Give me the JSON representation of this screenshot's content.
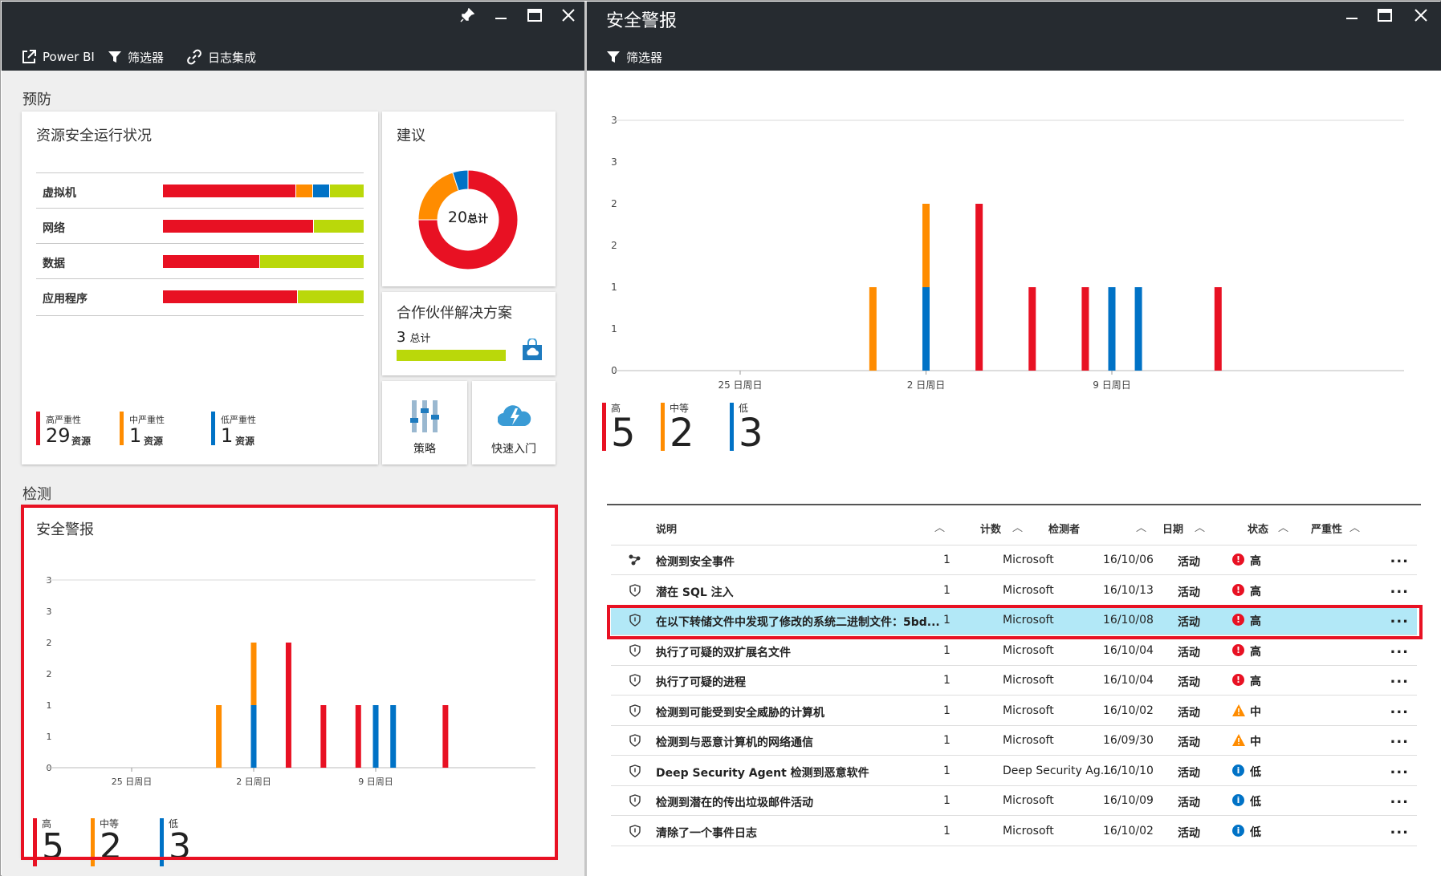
{
  "left_blade": {
    "toolbar": {
      "powerbi_label": "Power BI",
      "filter_label": "筛选器",
      "log_label": "日志集成"
    },
    "prevention": {
      "section_label": "预防",
      "resource_health": {
        "title": "资源安全运行状况",
        "rows": [
          {
            "label": "虚拟机",
            "high": 0.67,
            "medium": 0.08,
            "low": 0.08,
            "healthy": 0.17
          },
          {
            "label": "网络",
            "high": 0.75,
            "medium": 0,
            "low": 0,
            "healthy": 0.25
          },
          {
            "label": "数据",
            "high": 0.48,
            "medium": 0,
            "low": 0,
            "healthy": 0.52
          },
          {
            "label": "应用程序",
            "high": 0.67,
            "medium": 0,
            "low": 0,
            "healthy": 0.33
          }
        ],
        "severity": [
          {
            "caption": "高严重性",
            "count": "29",
            "unit": "资源",
            "color": "#e81123"
          },
          {
            "caption": "中严重性",
            "count": "1",
            "unit": "资源",
            "color": "#ff8c00"
          },
          {
            "caption": "低严重性",
            "count": "1",
            "unit": "资源",
            "color": "#0072c6"
          }
        ]
      },
      "recommendations": {
        "title": "建议",
        "total_number": "20",
        "total_label": "总计",
        "donut": [
          {
            "name": "high",
            "value": 15,
            "color": "#e81123"
          },
          {
            "name": "medium",
            "value": 4,
            "color": "#ff8c00"
          },
          {
            "name": "low",
            "value": 1,
            "color": "#0072c6"
          }
        ]
      },
      "partner": {
        "title": "合作伙伴解决方案",
        "count": "3",
        "count_label": "总计",
        "bar_fill": 1.0
      },
      "policy": {
        "label": "策略"
      },
      "quickstart": {
        "label": "快速入门"
      }
    },
    "detection": {
      "section_label": "检测",
      "alerts_tile": {
        "title": "安全警报"
      }
    }
  },
  "right_blade": {
    "title": "安全警报",
    "toolbar": {
      "filter_label": "筛选器"
    },
    "legend": [
      {
        "caption": "高",
        "count": "5",
        "color": "#e81123"
      },
      {
        "caption": "中等",
        "count": "2",
        "color": "#ff8c00"
      },
      {
        "caption": "低",
        "count": "3",
        "color": "#0072c6"
      }
    ],
    "table": {
      "columns": {
        "description": "说明",
        "count": "计数",
        "detector": "检测者",
        "date": "日期",
        "state": "状态",
        "severity": "严重性"
      },
      "rows": [
        {
          "icon": "incident-icon",
          "description": "检测到安全事件",
          "count": "1",
          "detector": "Microsoft",
          "date": "16/10/06",
          "state": "活动",
          "severity": "高",
          "level": "high",
          "selected": false
        },
        {
          "icon": "shield-icon",
          "description": "潜在 SQL 注入",
          "count": "1",
          "detector": "Microsoft",
          "date": "16/10/13",
          "state": "活动",
          "severity": "高",
          "level": "high",
          "selected": false
        },
        {
          "icon": "shield-icon",
          "description": "在以下转储文件中发现了修改的系统二进制文件：5bd...",
          "count": "1",
          "detector": "Microsoft",
          "date": "16/10/08",
          "state": "活动",
          "severity": "高",
          "level": "high",
          "selected": true
        },
        {
          "icon": "shield-icon",
          "description": "执行了可疑的双扩展名文件",
          "count": "1",
          "detector": "Microsoft",
          "date": "16/10/04",
          "state": "活动",
          "severity": "高",
          "level": "high",
          "selected": false
        },
        {
          "icon": "shield-icon",
          "description": "执行了可疑的进程",
          "count": "1",
          "detector": "Microsoft",
          "date": "16/10/04",
          "state": "活动",
          "severity": "高",
          "level": "high",
          "selected": false
        },
        {
          "icon": "shield-icon",
          "description": "检测到可能受到安全威胁的计算机",
          "count": "1",
          "detector": "Microsoft",
          "date": "16/10/02",
          "state": "活动",
          "severity": "中",
          "level": "medium",
          "selected": false
        },
        {
          "icon": "shield-icon",
          "description": "检测到与恶意计算机的网络通信",
          "count": "1",
          "detector": "Microsoft",
          "date": "16/09/30",
          "state": "活动",
          "severity": "中",
          "level": "medium",
          "selected": false
        },
        {
          "icon": "shield-icon",
          "description": "Deep Security Agent 检测到恶意软件",
          "count": "1",
          "detector": "Deep Security Ag...",
          "date": "16/10/10",
          "state": "活动",
          "severity": "低",
          "level": "low",
          "selected": false
        },
        {
          "icon": "shield-icon",
          "description": "检测到潜在的传出垃圾邮件活动",
          "count": "1",
          "detector": "Microsoft",
          "date": "16/10/09",
          "state": "活动",
          "severity": "低",
          "level": "low",
          "selected": false
        },
        {
          "icon": "shield-icon",
          "description": "清除了一个事件日志",
          "count": "1",
          "detector": "Microsoft",
          "date": "16/10/02",
          "state": "活动",
          "severity": "低",
          "level": "low",
          "selected": false
        }
      ],
      "more_label": "..."
    }
  },
  "chart_data": {
    "type": "bar",
    "stacked": true,
    "x_ticks": [
      "25 日周日",
      "2 日周日",
      "9 日周日"
    ],
    "y_ticks": [
      "0",
      "1",
      "1",
      "2",
      "2",
      "3",
      "3"
    ],
    "ylim": [
      0,
      3
    ],
    "series": [
      {
        "name": "高",
        "color": "#e81123",
        "points": [
          {
            "x": 0.51,
            "v": 0
          },
          {
            "x": 0.59,
            "v": 2
          },
          {
            "x": 0.69,
            "v": 1
          },
          {
            "x": 0.79,
            "v": 1
          },
          {
            "x": 0.98,
            "v": 1
          }
        ],
        "note": "x as position along date axis"
      },
      {
        "name": "中等",
        "color": "#ff8c00",
        "points": []
      },
      {
        "name": "低",
        "color": "#0072c6",
        "points": []
      }
    ],
    "bars": [
      {
        "date": "2016-09-30",
        "high": 0,
        "medium": 1,
        "low": 0
      },
      {
        "date": "2016-10-02",
        "high": 0,
        "medium": 1,
        "low": 1
      },
      {
        "date": "2016-10-04",
        "high": 2,
        "medium": 0,
        "low": 0
      },
      {
        "date": "2016-10-06",
        "high": 1,
        "medium": 0,
        "low": 0
      },
      {
        "date": "2016-10-08",
        "high": 1,
        "medium": 0,
        "low": 0
      },
      {
        "date": "2016-10-09",
        "high": 0,
        "medium": 0,
        "low": 1
      },
      {
        "date": "2016-10-10",
        "high": 0,
        "medium": 0,
        "low": 1
      },
      {
        "date": "2016-10-13",
        "high": 1,
        "medium": 0,
        "low": 0
      }
    ]
  }
}
